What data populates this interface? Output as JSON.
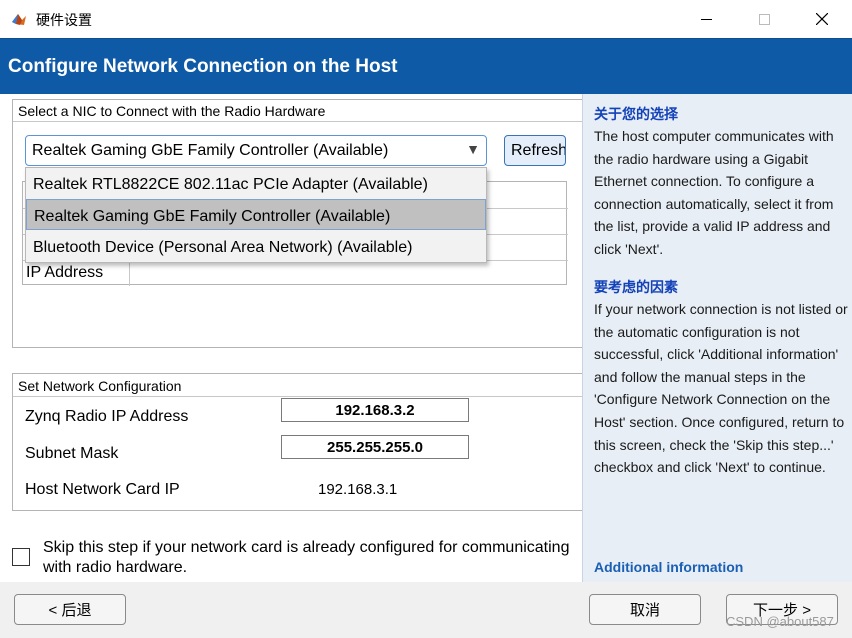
{
  "window": {
    "title": "硬件设置"
  },
  "header": {
    "title": "Configure Network Connection on the Host"
  },
  "nic_panel": {
    "title": "Select a NIC to Connect with the Radio Hardware",
    "selected": "Realtek Gaming GbE Family Controller (Available)",
    "refresh_label": "Refresh",
    "options": [
      "Realtek RTL8822CE 802.11ac PCIe Adapter (Available)",
      "Realtek Gaming GbE Family Controller (Available)",
      "Bluetooth Device (Personal Area Network) (Available)"
    ],
    "ip_label": "IP Address"
  },
  "net_config": {
    "title": "Set Network Configuration",
    "zynq_label": "Zynq Radio IP Address",
    "zynq_value": "192.168.3.2",
    "subnet_label": "Subnet Mask",
    "subnet_value": "255.255.255.0",
    "host_label": "Host Network Card IP",
    "host_value": "192.168.3.1"
  },
  "skip": {
    "text": "Skip this step if your network card is already configured for communicating with radio hardware.",
    "checked": false
  },
  "help": {
    "heading1": "关于您的选择",
    "para1": "The host computer communicates with the radio hardware using a Gigabit Ethernet connection. To configure a connection automatically, select it from the list, provide a valid IP address and click 'Next'.",
    "heading2": "要考虑的因素",
    "para2": "If your network connection is not listed or the automatic configuration is not successful, click 'Additional information' and follow the manual steps in the 'Configure Network Connection on the Host' section. Once configured, return to this screen, check the 'Skip this step...' checkbox and click 'Next' to continue.",
    "link": "Additional information"
  },
  "footer": {
    "back_label": "< 后退",
    "cancel_label": "取消",
    "next_label": "下一步 >",
    "watermark": "CSDN @about587"
  },
  "colors": {
    "header_bg": "#0e5aa6",
    "help_bg": "#e7eef6",
    "help_heading": "#1442b8"
  }
}
